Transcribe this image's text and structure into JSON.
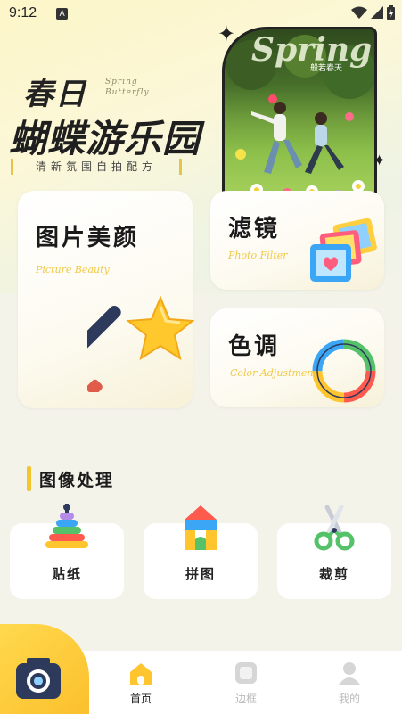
{
  "status": {
    "time": "9:12",
    "notif_glyph": "A"
  },
  "hero": {
    "title_line1": "春日",
    "title_script": "Spring Butterfly",
    "title_line2": "蝴蝶游乐园",
    "subtitle": "清新氛围自拍配方",
    "photo_title": "Spring",
    "photo_sub": "般若春天"
  },
  "cards": {
    "beauty": {
      "title": "图片美颜",
      "en": "Picture Beauty"
    },
    "filter": {
      "title": "滤镜",
      "en": "Photo Filter"
    },
    "color": {
      "title": "色调",
      "en": "Color Adjustment"
    }
  },
  "section": {
    "title": "图像处理"
  },
  "tools": [
    {
      "label": "贴纸",
      "icon": "rainbow-stacker-icon"
    },
    {
      "label": "拼图",
      "icon": "building-blocks-icon"
    },
    {
      "label": "裁剪",
      "icon": "scissors-icon"
    }
  ],
  "nav": {
    "home": "首页",
    "frame": "边框",
    "mine": "我的"
  },
  "colors": {
    "accent": "#f3c52f",
    "nav_active": "#222222",
    "nav_inactive": "#bbbbbb"
  }
}
